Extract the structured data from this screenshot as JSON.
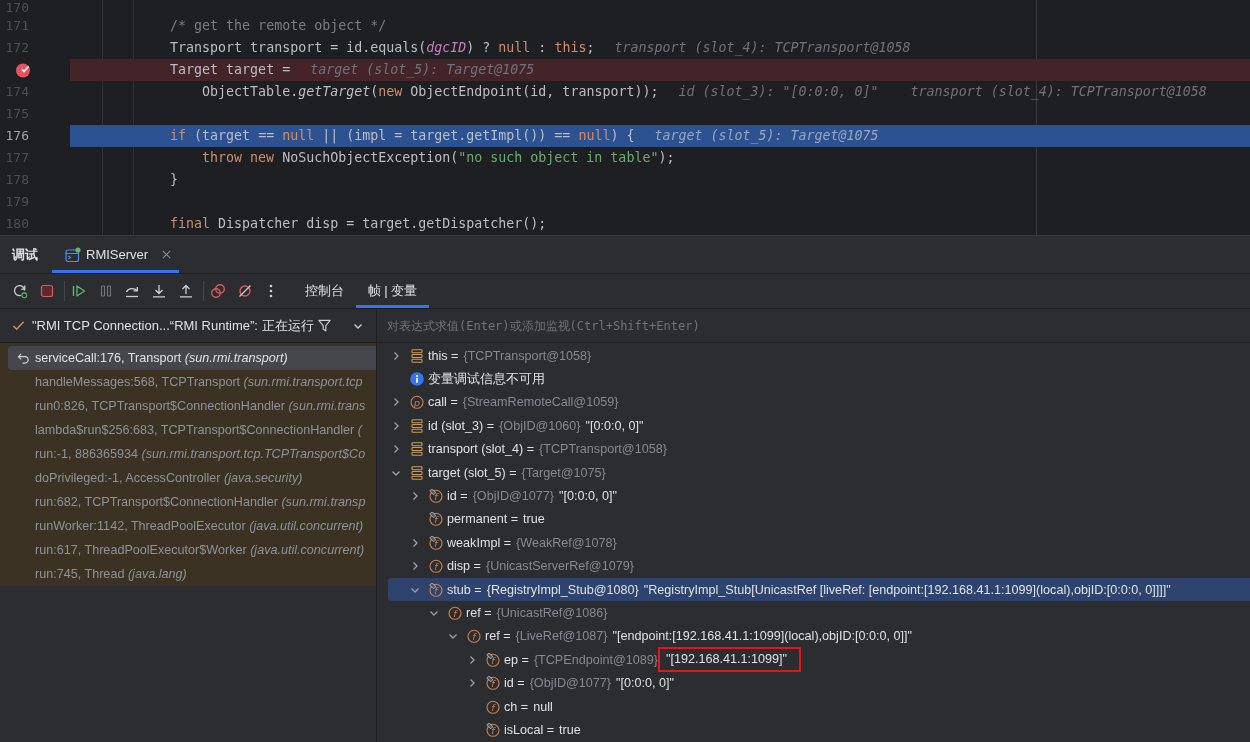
{
  "editor": {
    "lines": [
      {
        "number": "170",
        "breakpoint": false,
        "execution_point": false
      },
      {
        "number": "171",
        "breakpoint": false,
        "execution_point": false,
        "tokens": [
          {
            "kind": "comment",
            "text": "            /* get the remote object */"
          }
        ]
      },
      {
        "number": "172",
        "breakpoint": false,
        "execution_point": false,
        "tokens": [
          {
            "kind": "plain",
            "text": "            Transport transport = id.equals("
          },
          {
            "kind": "field",
            "text": "dgcID"
          },
          {
            "kind": "plain",
            "text": ") ? "
          },
          {
            "kind": "keyword",
            "text": "null"
          },
          {
            "kind": "plain",
            "text": " : "
          },
          {
            "kind": "keyword",
            "text": "this"
          },
          {
            "kind": "plain",
            "text": ";"
          }
        ],
        "hints": [
          "transport (slot_4): TCPTransport@1058"
        ]
      },
      {
        "breakpoint": true,
        "execution_point": false,
        "tokens": [
          {
            "kind": "plain",
            "text": "            Target target ="
          }
        ],
        "hints": [
          "target (slot_5): Target@1075"
        ]
      },
      {
        "number": "174",
        "breakpoint": false,
        "execution_point": false,
        "tokens": [
          {
            "kind": "plain",
            "text": "                ObjectTable."
          },
          {
            "kind": "static_call",
            "text": "getTarget"
          },
          {
            "kind": "plain",
            "text": "("
          },
          {
            "kind": "keyword",
            "text": "new"
          },
          {
            "kind": "plain",
            "text": " ObjectEndpoint(id, transport));"
          }
        ],
        "hints": [
          "id (slot_3): \"[0:0:0, 0]\"",
          "transport (slot_4): TCPTransport@1058"
        ]
      },
      {
        "number": "175",
        "breakpoint": false,
        "execution_point": false
      },
      {
        "number": "176",
        "breakpoint": false,
        "execution_point": true,
        "tokens": [
          {
            "kind": "keyword",
            "text": "            if"
          },
          {
            "kind": "plain",
            "text": " (target == "
          },
          {
            "kind": "keyword",
            "text": "null"
          },
          {
            "kind": "plain",
            "text": " || (impl = target.getImpl()) == "
          },
          {
            "kind": "keyword",
            "text": "null"
          },
          {
            "kind": "plain",
            "text": ") {"
          }
        ],
        "hints": [
          "target (slot_5): Target@1075"
        ]
      },
      {
        "number": "177",
        "breakpoint": false,
        "execution_point": false,
        "tokens": [
          {
            "kind": "keyword",
            "text": "                throw new"
          },
          {
            "kind": "plain",
            "text": " NoSuchObjectException("
          },
          {
            "kind": "string",
            "text": "\"no such object in table\""
          },
          {
            "kind": "plain",
            "text": ");"
          }
        ]
      },
      {
        "number": "178",
        "breakpoint": false,
        "execution_point": false,
        "tokens": [
          {
            "kind": "plain",
            "text": "            }"
          }
        ]
      },
      {
        "number": "179",
        "breakpoint": false,
        "execution_point": false
      },
      {
        "number": "180",
        "breakpoint": false,
        "execution_point": false,
        "tokens": [
          {
            "kind": "keyword",
            "text": "            final"
          },
          {
            "kind": "plain",
            "text": " Dispatcher disp = target.getDispatcher();"
          }
        ]
      }
    ]
  },
  "debug_panel": {
    "title": "调试",
    "tabs": [
      {
        "label": "RMIServer",
        "selected": true
      }
    ]
  },
  "toolbar": [
    [
      {
        "kind": "restart",
        "disabled": false
      },
      {
        "kind": "stop",
        "disabled": false
      }
    ],
    [
      {
        "kind": "resume",
        "disabled": false
      },
      {
        "kind": "pause",
        "disabled": true
      },
      {
        "kind": "step_over",
        "disabled": false
      },
      {
        "kind": "step_into",
        "disabled": false
      },
      {
        "kind": "step_out",
        "disabled": false
      }
    ],
    [
      {
        "kind": "breakpoints",
        "disabled": false
      },
      {
        "kind": "mute_breakpoints",
        "disabled": false
      },
      {
        "kind": "more",
        "disabled": false
      }
    ]
  ],
  "view_tabs": [
    {
      "label": "控制台",
      "selected": false
    },
    {
      "label": "帧 | 变量",
      "selected": true
    }
  ],
  "thread_selector": {
    "label": "\"RMI TCP Connection...“RMI Runtime”: 正在运行"
  },
  "evaluate_field": {
    "placeholder": "对表达式求值(Enter)或添加监视(Ctrl+Shift+Enter)"
  },
  "frames": [
    {
      "text": "serviceCall:176, Transport *(sun.rmi.transport)*",
      "selected": true
    },
    {
      "text": "handleMessages:568, TCPTransport *(sun.rmi.transport.tcp*",
      "selected": false
    },
    {
      "text": "run0:826, TCPTransport$ConnectionHandler *(sun.rmi.trans*",
      "selected": false
    },
    {
      "text": "lambda$run$256:683, TCPTransport$ConnectionHandler *(*",
      "selected": false
    },
    {
      "text": "run:-1, 886365934 *(sun.rmi.transport.tcp.TCPTransport$Co*",
      "selected": false
    },
    {
      "text": "doPrivileged:-1, AccessController *(java.security)*",
      "selected": false
    },
    {
      "text": "run:682, TCPTransport$ConnectionHandler *(sun.rmi.transp*",
      "selected": false
    },
    {
      "text": "runWorker:1142, ThreadPoolExecutor *(java.util.concurrent)*",
      "selected": false
    },
    {
      "text": "run:617, ThreadPoolExecutor$Worker *(java.util.concurrent)*",
      "selected": false
    },
    {
      "text": "run:745, Thread *(java.lang)*",
      "selected": false
    }
  ],
  "variables": [
    {
      "kind": "local",
      "name": "this =",
      "type": "{TCPTransport@1058}",
      "expanded": false,
      "selected": false
    },
    {
      "kind": "info",
      "name": "变量调试信息不可用",
      "selected": false
    },
    {
      "kind": "param",
      "letter": "p",
      "name": "call =",
      "type": "{StreamRemoteCall@1059}",
      "expanded": false,
      "selected": false
    },
    {
      "kind": "local",
      "name": "id (slot_3) =",
      "type": "{ObjID@1060}",
      "value": "\"[0:0:0, 0]\"",
      "expanded": false,
      "selected": false
    },
    {
      "kind": "local",
      "name": "transport (slot_4) =",
      "type": "{TCPTransport@1058}",
      "expanded": false,
      "selected": false
    },
    {
      "kind": "local",
      "name": "target (slot_5) =",
      "type": "{Target@1075}",
      "expanded": true,
      "selected": false,
      "children": [
        {
          "kind": "field",
          "letter": "f",
          "final": true,
          "name": "id =",
          "type": "{ObjID@1077}",
          "value": "\"[0:0:0, 0]\"",
          "expanded": false,
          "selected": false
        },
        {
          "kind": "field",
          "letter": "f",
          "final": true,
          "name": "permanent =",
          "value": "true",
          "selected": false
        },
        {
          "kind": "field",
          "letter": "f",
          "final": true,
          "name": "weakImpl =",
          "type": "{WeakRef@1078}",
          "expanded": false,
          "selected": false
        },
        {
          "kind": "field",
          "letter": "f",
          "final": false,
          "name": "disp =",
          "type": "{UnicastServerRef@1079}",
          "expanded": false,
          "selected": false
        },
        {
          "kind": "field",
          "letter": "f",
          "final": true,
          "name": "stub =",
          "type": "{RegistryImpl_Stub@1080}",
          "value": "\"RegistryImpl_Stub[UnicastRef [liveRef: [endpoint:[192.168.41.1:1099](local),objID:[0:0:0, 0]]]]\"",
          "expanded": true,
          "selected": true,
          "children": [
            {
              "kind": "field",
              "letter": "f",
              "final": false,
              "name": "ref =",
              "type": "{UnicastRef@1086}",
              "expanded": true,
              "selected": false,
              "children": [
                {
                  "kind": "field",
                  "letter": "f",
                  "final": false,
                  "name": "ref =",
                  "type": "{LiveRef@1087}",
                  "value": "\"[endpoint:[192.168.41.1:1099](local),objID:[0:0:0, 0]]\"",
                  "expanded": true,
                  "selected": false,
                  "children": [
                    {
                      "kind": "field",
                      "letter": "f",
                      "final": true,
                      "name": "ep =",
                      "type": "{TCPEndpoint@1089}",
                      "value": "\"[192.168.41.1:1099]\"",
                      "expanded": false,
                      "selected": false,
                      "highlighted": true
                    },
                    {
                      "kind": "field",
                      "letter": "f",
                      "final": true,
                      "name": "id =",
                      "type": "{ObjID@1077}",
                      "value": "\"[0:0:0, 0]\"",
                      "expanded": false,
                      "selected": false
                    },
                    {
                      "kind": "field",
                      "letter": "f",
                      "final": false,
                      "name": "ch =",
                      "value": "null",
                      "selected": false
                    },
                    {
                      "kind": "field",
                      "letter": "f",
                      "final": true,
                      "name": "isLocal =",
                      "value": "true",
                      "selected": false
                    }
                  ]
                }
              ]
            }
          ]
        }
      ]
    }
  ]
}
